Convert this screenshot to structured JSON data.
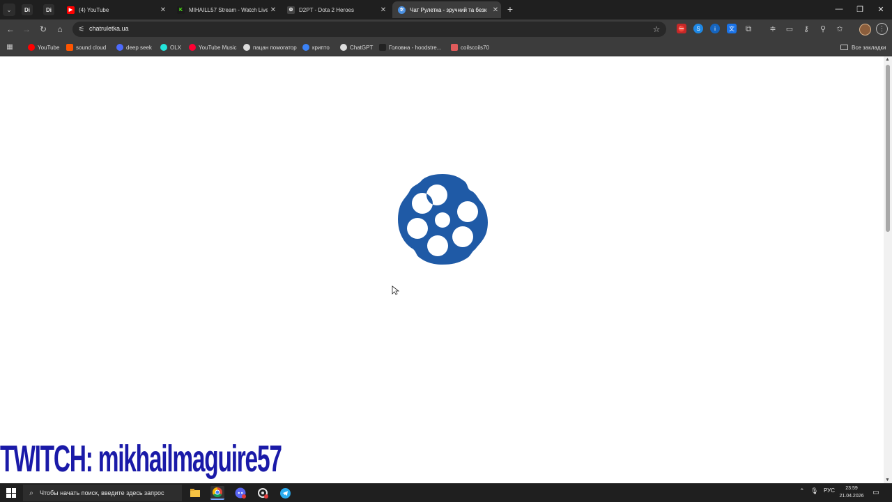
{
  "browser": {
    "pinned_tabs": [
      {
        "label": "Di"
      },
      {
        "label": "Di"
      }
    ],
    "tabs": [
      {
        "title": "(4) YouTube",
        "favicon": "youtube-icon",
        "favicon_color": "#ff0000"
      },
      {
        "title": "MIHAILL57 Stream - Watch Live",
        "favicon": "kick-icon",
        "favicon_color": "#53fc18"
      },
      {
        "title": "D2PT - Dota 2 Heroes",
        "favicon": "d2pt-icon",
        "favicon_color": "#888888"
      },
      {
        "title": "Чат Рулетка - зручний та безк",
        "favicon": "chatruletka-icon",
        "favicon_color": "#4a90e2",
        "active": true
      }
    ],
    "url": "chatruletka.ua",
    "bookmarks": [
      {
        "label": "YouTube",
        "color": "#ff0000"
      },
      {
        "label": "sound cloud",
        "color": "#ff5500"
      },
      {
        "label": "deep seek",
        "color": "#4d6bfe"
      },
      {
        "label": "OLX",
        "color": "#23e5db"
      },
      {
        "label": "YouTube Music",
        "color": "#ff0033"
      },
      {
        "label": "пацан помогатор",
        "color": "#dddddd"
      },
      {
        "label": "крипто",
        "color": "#3b82f6"
      },
      {
        "label": "ChatGPT",
        "color": "#dddddd"
      },
      {
        "label": "Головна - hoodstre...",
        "color": "#222222"
      },
      {
        "label": "coilscoils70",
        "color": "#e05b5b"
      }
    ],
    "all_bookmarks_label": "Все закладки"
  },
  "page": {
    "loader_icon": "revolver-cylinder-icon",
    "loader_color": "#1f5aa6"
  },
  "stream_overlay": {
    "text": "TWITCH: mikhailmaguire57",
    "color": "#1a1aa8"
  },
  "taskbar": {
    "search_placeholder": "Чтобы начать поиск, введите здесь запрос",
    "apps": [
      "file-explorer-icon",
      "chrome-icon",
      "discord-icon",
      "steelseries-icon",
      "telegram-icon"
    ],
    "language": "РУС",
    "time": "23:59",
    "date": "21.04.2026"
  }
}
